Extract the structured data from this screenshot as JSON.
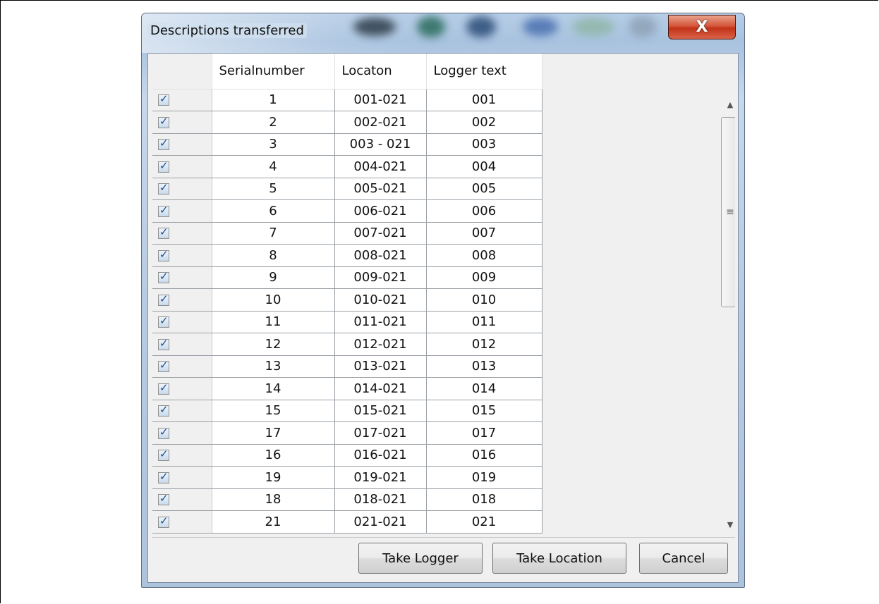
{
  "window": {
    "title": "Descriptions transferred",
    "close_glyph": "X",
    "close_icon": "close-icon"
  },
  "grid": {
    "columns": [
      "",
      "Serialnumber",
      "Locaton",
      "Logger text"
    ],
    "rows": [
      {
        "checked": true,
        "serial": "1",
        "location": "001-021",
        "logger": "001"
      },
      {
        "checked": true,
        "serial": "2",
        "location": "002-021",
        "logger": "002"
      },
      {
        "checked": true,
        "serial": "3",
        "location": "003 - 021",
        "logger": "003"
      },
      {
        "checked": true,
        "serial": "4",
        "location": "004-021",
        "logger": "004"
      },
      {
        "checked": true,
        "serial": "5",
        "location": "005-021",
        "logger": "005"
      },
      {
        "checked": true,
        "serial": "6",
        "location": "006-021",
        "logger": "006"
      },
      {
        "checked": true,
        "serial": "7",
        "location": "007-021",
        "logger": "007"
      },
      {
        "checked": true,
        "serial": "8",
        "location": "008-021",
        "logger": "008"
      },
      {
        "checked": true,
        "serial": "9",
        "location": "009-021",
        "logger": "009"
      },
      {
        "checked": true,
        "serial": "10",
        "location": "010-021",
        "logger": "010"
      },
      {
        "checked": true,
        "serial": "11",
        "location": "011-021",
        "logger": "011"
      },
      {
        "checked": true,
        "serial": "12",
        "location": "012-021",
        "logger": "012"
      },
      {
        "checked": true,
        "serial": "13",
        "location": "013-021",
        "logger": "013"
      },
      {
        "checked": true,
        "serial": "14",
        "location": "014-021",
        "logger": "014"
      },
      {
        "checked": true,
        "serial": "15",
        "location": "015-021",
        "logger": "015"
      },
      {
        "checked": true,
        "serial": "17",
        "location": "017-021",
        "logger": "017"
      },
      {
        "checked": true,
        "serial": "16",
        "location": "016-021",
        "logger": "016"
      },
      {
        "checked": true,
        "serial": "19",
        "location": "019-021",
        "logger": "019"
      },
      {
        "checked": true,
        "serial": "18",
        "location": "018-021",
        "logger": "018"
      },
      {
        "checked": true,
        "serial": "21",
        "location": "021-021",
        "logger": "021"
      }
    ]
  },
  "scrollbar": {
    "up_icon": "scroll-up-arrow-icon",
    "down_icon": "scroll-down-arrow-icon",
    "up_glyph": "▲",
    "down_glyph": "▼",
    "grip_glyph": "≡"
  },
  "buttons": {
    "take_logger": "Take Logger",
    "take_location": "Take Location",
    "cancel": "Cancel"
  }
}
